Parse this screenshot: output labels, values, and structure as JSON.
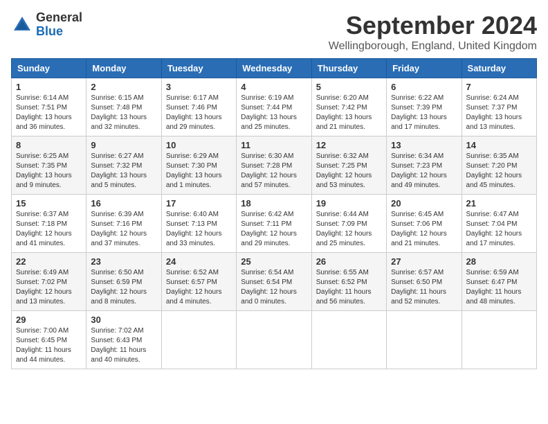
{
  "logo": {
    "general": "General",
    "blue": "Blue"
  },
  "title": "September 2024",
  "location": "Wellingborough, England, United Kingdom",
  "days_header": [
    "Sunday",
    "Monday",
    "Tuesday",
    "Wednesday",
    "Thursday",
    "Friday",
    "Saturday"
  ],
  "weeks": [
    [
      {
        "day": "1",
        "sunrise": "6:14 AM",
        "sunset": "7:51 PM",
        "daylight_h": "13",
        "daylight_m": "36"
      },
      {
        "day": "2",
        "sunrise": "6:15 AM",
        "sunset": "7:48 PM",
        "daylight_h": "13",
        "daylight_m": "32"
      },
      {
        "day": "3",
        "sunrise": "6:17 AM",
        "sunset": "7:46 PM",
        "daylight_h": "13",
        "daylight_m": "29"
      },
      {
        "day": "4",
        "sunrise": "6:19 AM",
        "sunset": "7:44 PM",
        "daylight_h": "13",
        "daylight_m": "25"
      },
      {
        "day": "5",
        "sunrise": "6:20 AM",
        "sunset": "7:42 PM",
        "daylight_h": "13",
        "daylight_m": "21"
      },
      {
        "day": "6",
        "sunrise": "6:22 AM",
        "sunset": "7:39 PM",
        "daylight_h": "13",
        "daylight_m": "17"
      },
      {
        "day": "7",
        "sunrise": "6:24 AM",
        "sunset": "7:37 PM",
        "daylight_h": "13",
        "daylight_m": "13"
      }
    ],
    [
      {
        "day": "8",
        "sunrise": "6:25 AM",
        "sunset": "7:35 PM",
        "daylight_h": "13",
        "daylight_m": "9"
      },
      {
        "day": "9",
        "sunrise": "6:27 AM",
        "sunset": "7:32 PM",
        "daylight_h": "13",
        "daylight_m": "5"
      },
      {
        "day": "10",
        "sunrise": "6:29 AM",
        "sunset": "7:30 PM",
        "daylight_h": "13",
        "daylight_m": "1"
      },
      {
        "day": "11",
        "sunrise": "6:30 AM",
        "sunset": "7:28 PM",
        "daylight_h": "12",
        "daylight_m": "57"
      },
      {
        "day": "12",
        "sunrise": "6:32 AM",
        "sunset": "7:25 PM",
        "daylight_h": "12",
        "daylight_m": "53"
      },
      {
        "day": "13",
        "sunrise": "6:34 AM",
        "sunset": "7:23 PM",
        "daylight_h": "12",
        "daylight_m": "49"
      },
      {
        "day": "14",
        "sunrise": "6:35 AM",
        "sunset": "7:20 PM",
        "daylight_h": "12",
        "daylight_m": "45"
      }
    ],
    [
      {
        "day": "15",
        "sunrise": "6:37 AM",
        "sunset": "7:18 PM",
        "daylight_h": "12",
        "daylight_m": "41"
      },
      {
        "day": "16",
        "sunrise": "6:39 AM",
        "sunset": "7:16 PM",
        "daylight_h": "12",
        "daylight_m": "37"
      },
      {
        "day": "17",
        "sunrise": "6:40 AM",
        "sunset": "7:13 PM",
        "daylight_h": "12",
        "daylight_m": "33"
      },
      {
        "day": "18",
        "sunrise": "6:42 AM",
        "sunset": "7:11 PM",
        "daylight_h": "12",
        "daylight_m": "29"
      },
      {
        "day": "19",
        "sunrise": "6:44 AM",
        "sunset": "7:09 PM",
        "daylight_h": "12",
        "daylight_m": "25"
      },
      {
        "day": "20",
        "sunrise": "6:45 AM",
        "sunset": "7:06 PM",
        "daylight_h": "12",
        "daylight_m": "21"
      },
      {
        "day": "21",
        "sunrise": "6:47 AM",
        "sunset": "7:04 PM",
        "daylight_h": "12",
        "daylight_m": "17"
      }
    ],
    [
      {
        "day": "22",
        "sunrise": "6:49 AM",
        "sunset": "7:02 PM",
        "daylight_h": "12",
        "daylight_m": "13"
      },
      {
        "day": "23",
        "sunrise": "6:50 AM",
        "sunset": "6:59 PM",
        "daylight_h": "12",
        "daylight_m": "8"
      },
      {
        "day": "24",
        "sunrise": "6:52 AM",
        "sunset": "6:57 PM",
        "daylight_h": "12",
        "daylight_m": "4"
      },
      {
        "day": "25",
        "sunrise": "6:54 AM",
        "sunset": "6:54 PM",
        "daylight_h": "12",
        "daylight_m": "0"
      },
      {
        "day": "26",
        "sunrise": "6:55 AM",
        "sunset": "6:52 PM",
        "daylight_h": "11",
        "daylight_m": "56"
      },
      {
        "day": "27",
        "sunrise": "6:57 AM",
        "sunset": "6:50 PM",
        "daylight_h": "11",
        "daylight_m": "52"
      },
      {
        "day": "28",
        "sunrise": "6:59 AM",
        "sunset": "6:47 PM",
        "daylight_h": "11",
        "daylight_m": "48"
      }
    ],
    [
      {
        "day": "29",
        "sunrise": "7:00 AM",
        "sunset": "6:45 PM",
        "daylight_h": "11",
        "daylight_m": "44"
      },
      {
        "day": "30",
        "sunrise": "7:02 AM",
        "sunset": "6:43 PM",
        "daylight_h": "11",
        "daylight_m": "40"
      },
      null,
      null,
      null,
      null,
      null
    ]
  ],
  "labels": {
    "sunrise": "Sunrise:",
    "sunset": "Sunset:",
    "daylight": "Daylight:"
  }
}
